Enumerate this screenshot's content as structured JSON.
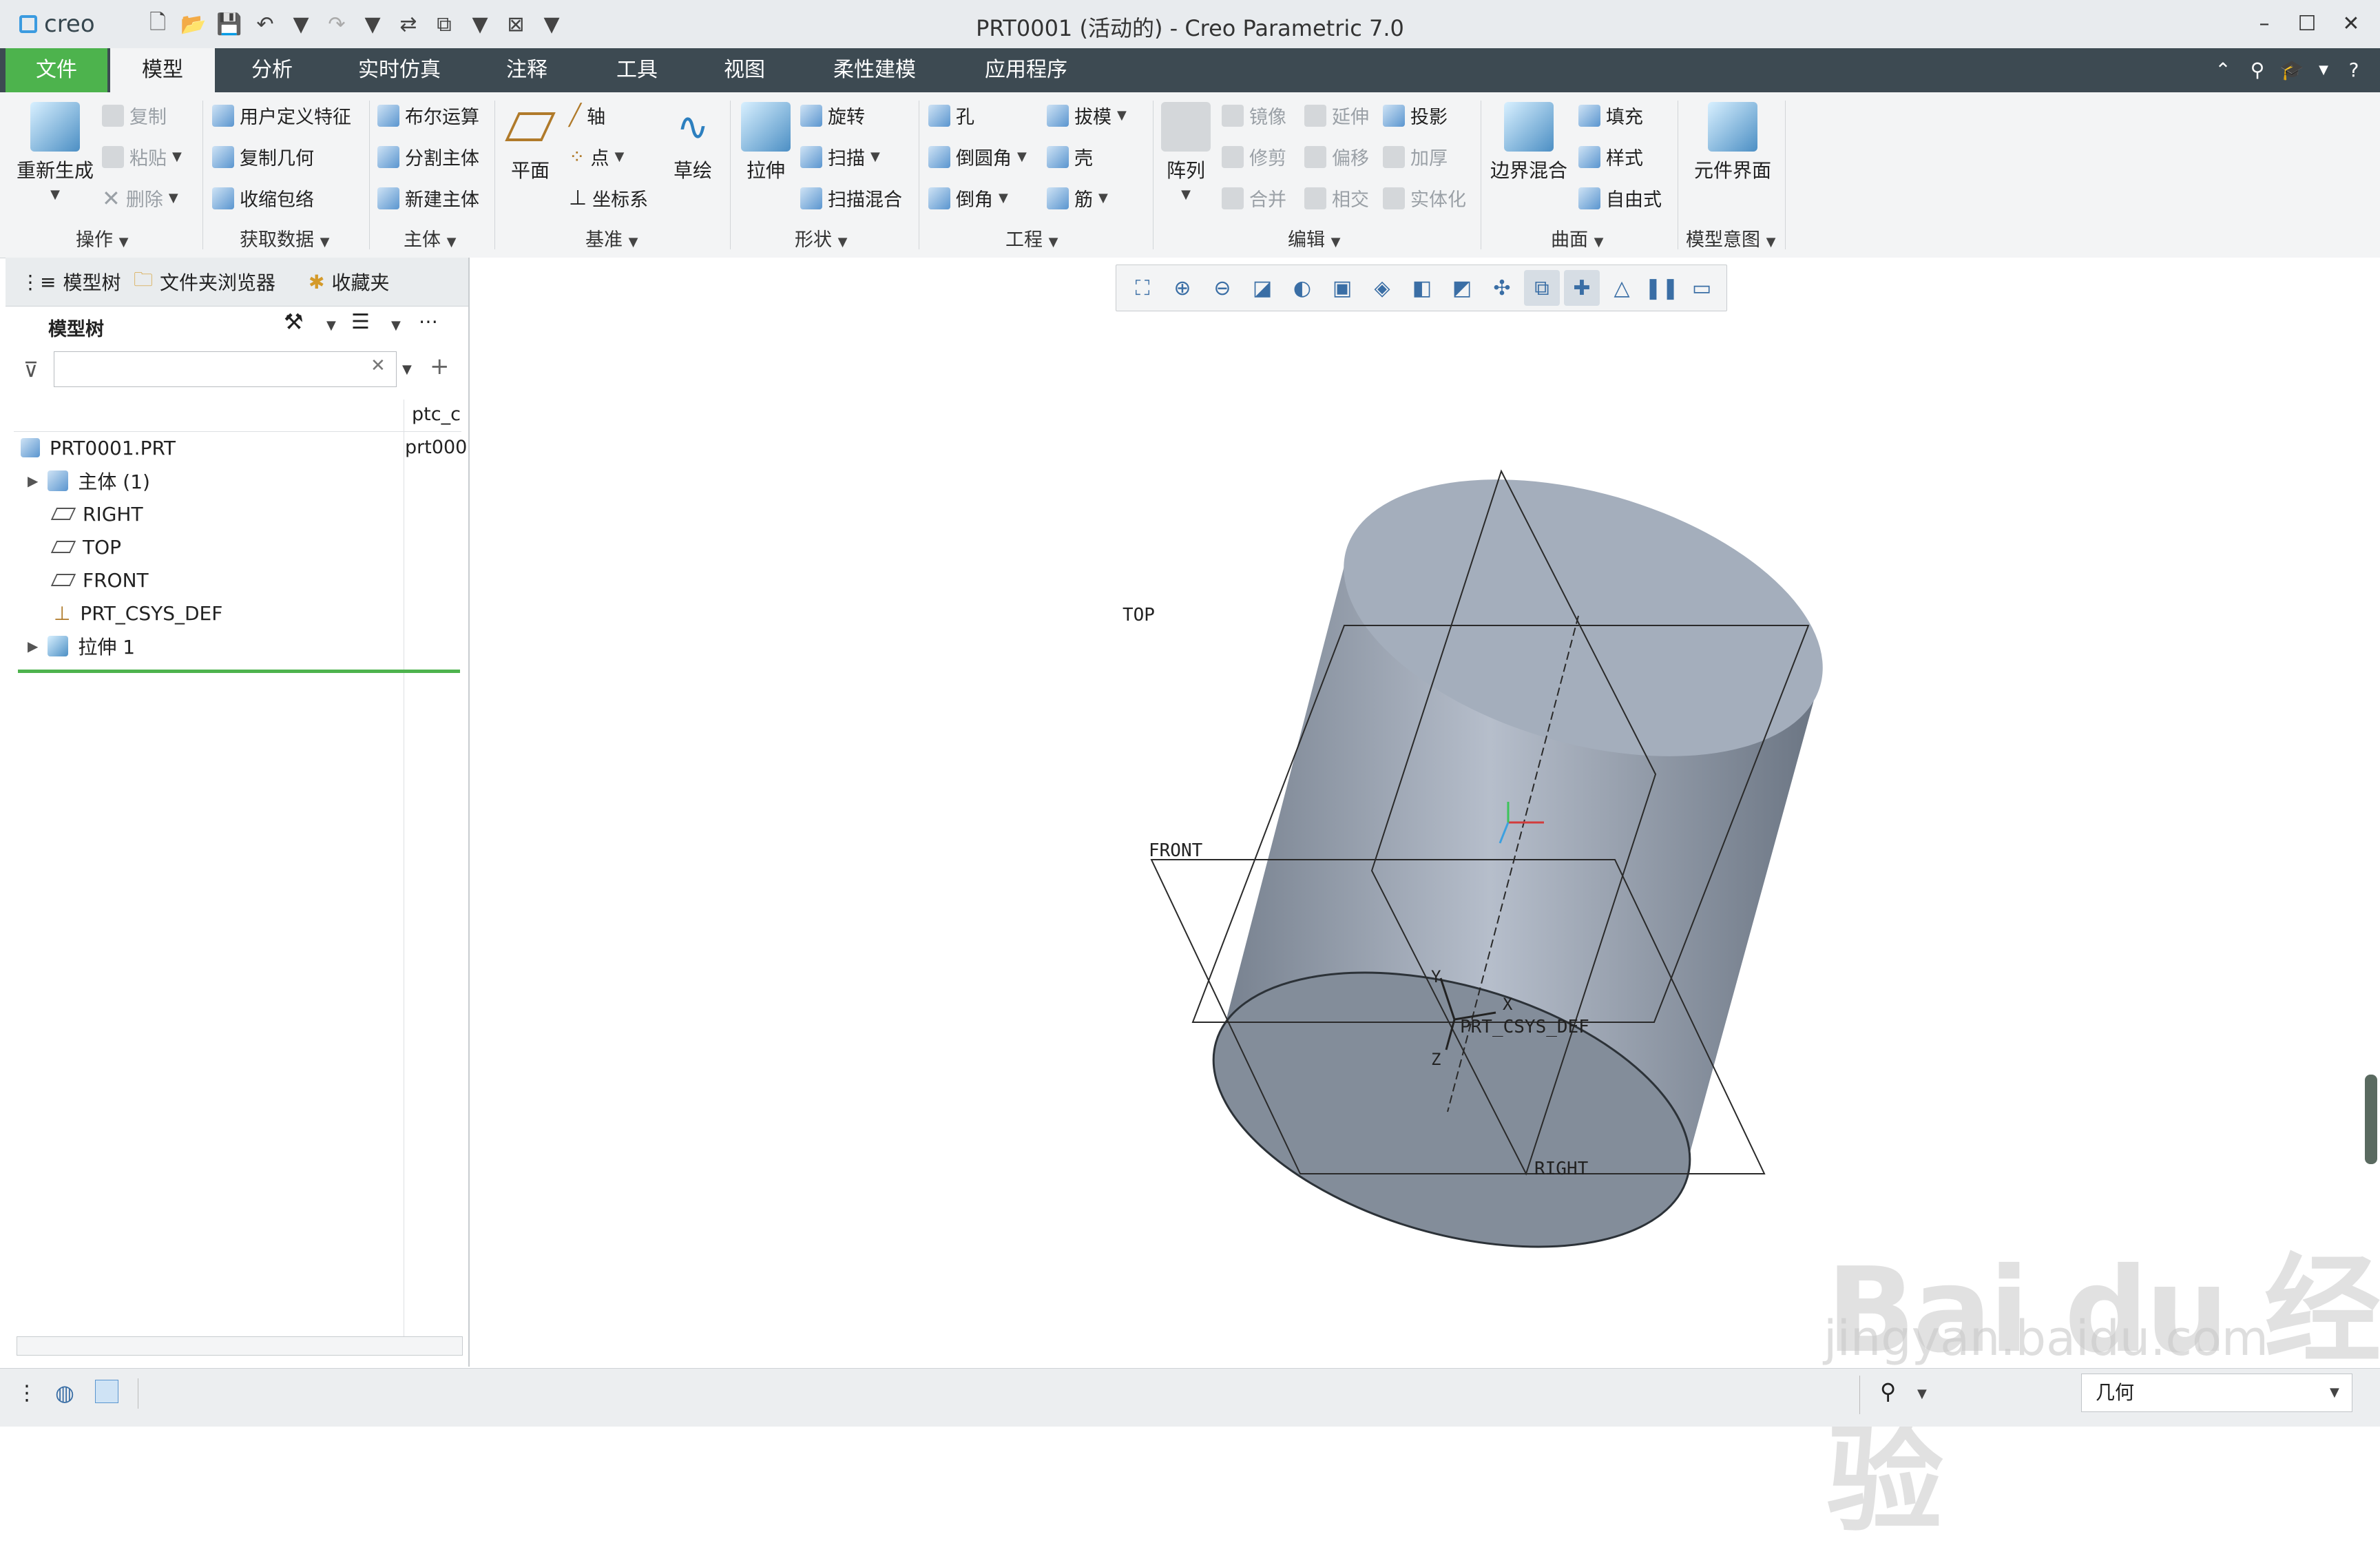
{
  "app": {
    "logo": "creo",
    "window_title": "PRT0001 (活动的) - Creo Parametric 7.0"
  },
  "qat": [
    "new-icon",
    "open-icon",
    "save-icon",
    "undo-icon",
    "redo-icon",
    "regenerate-icon",
    "windows-icon",
    "close-icon",
    "customize-icon"
  ],
  "tabs": [
    "文件",
    "模型",
    "分析",
    "实时仿真",
    "注释",
    "工具",
    "视图",
    "柔性建模",
    "应用程序"
  ],
  "ribbon": {
    "regenerate": "重新生成",
    "copy": "复制",
    "paste": "粘贴",
    "delete": "删除",
    "udf": "用户定义特征",
    "copy_geom": "复制几何",
    "shrinkwrap": "收缩包络",
    "boolean": "布尔运算",
    "split_body": "分割主体",
    "new_body": "新建主体",
    "plane": "平面",
    "axis": "轴",
    "point": "点",
    "csys": "坐标系",
    "sketch": "草绘",
    "extrude": "拉伸",
    "revolve": "旋转",
    "sweep": "扫描",
    "swept_blend": "扫描混合",
    "hole": "孔",
    "round": "倒圆角",
    "chamfer": "倒角",
    "draft": "拔模",
    "shell": "壳",
    "rib": "筋",
    "pattern": "阵列",
    "mirror": "镜像",
    "extend": "延伸",
    "project": "投影",
    "trim": "修剪",
    "offset": "偏移",
    "thicken": "加厚",
    "merge": "合并",
    "intersect": "相交",
    "solidify": "实体化",
    "boundary_blend": "边界混合",
    "fill": "填充",
    "style": "样式",
    "freestyle": "自由式",
    "component_interface": "元件界面",
    "groups": [
      "操作",
      "获取数据",
      "主体",
      "基准",
      "形状",
      "工程",
      "编辑",
      "曲面",
      "模型意图"
    ]
  },
  "navigator": {
    "tabs": [
      "模型树",
      "文件夹浏览器",
      "收藏夹"
    ],
    "header": "模型树",
    "column": "ptc_c",
    "items": [
      {
        "label": "PRT0001.PRT",
        "value": "prt000"
      },
      {
        "label": "主体 (1)"
      },
      {
        "label": "RIGHT"
      },
      {
        "label": "TOP"
      },
      {
        "label": "FRONT"
      },
      {
        "label": "PRT_CSYS_DEF"
      },
      {
        "label": "拉伸 1"
      }
    ]
  },
  "graphics": {
    "labels": {
      "top": "TOP",
      "front": "FRONT",
      "right": "RIGHT",
      "csys": "PRT_CSYS_DEF",
      "x": "X",
      "y": "Y",
      "z": "Z"
    }
  },
  "status": {
    "filter": "几何"
  },
  "watermark": {
    "line1": "Bai du 经验",
    "line2": "jingyan.baidu.com"
  },
  "colors": {
    "tabbar": "#3d4a52",
    "file_tab": "#4db34d",
    "solid_fill": "#8c96a4"
  }
}
